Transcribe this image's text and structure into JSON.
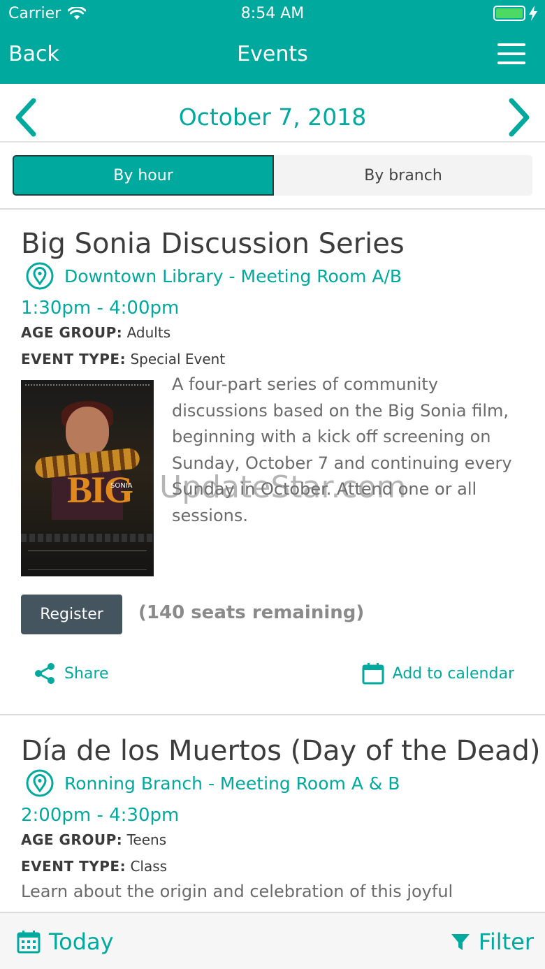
{
  "status_bar": {
    "carrier": "Carrier",
    "time": "8:54 AM"
  },
  "nav": {
    "back_label": "Back",
    "title": "Events"
  },
  "date_nav": {
    "date": "October 7, 2018"
  },
  "view_toggle": {
    "by_hour": "By hour",
    "by_branch": "By branch",
    "selected": "By hour"
  },
  "events": [
    {
      "title": "Big Sonia Discussion Series",
      "location": "Downtown Library - Meeting Room A/B",
      "time": "1:30pm - 4:00pm",
      "age_group_label": "AGE GROUP:",
      "age_group": "Adults",
      "event_type_label": "EVENT TYPE:",
      "event_type": "Special Event",
      "description": "A four-part series of community discussions based on the Big Sonia film, beginning with a kick off screening on Sunday, October 7 and continuing every Sunday in October. Attend one or all sessions.",
      "poster_text": "BIG",
      "poster_subtext": "SONIA",
      "register_label": "Register",
      "seats": "(140 seats remaining)",
      "share_label": "Share",
      "calendar_label": "Add to calendar"
    },
    {
      "title": "Día de los Muertos (Day of the Dead)",
      "location": "Ronning Branch - Meeting Room A & B",
      "time": "2:00pm - 4:30pm",
      "age_group_label": "AGE GROUP:",
      "age_group": "Teens",
      "event_type_label": "EVENT TYPE:",
      "event_type": "Class",
      "description": "Learn about the origin and celebration of this joyful"
    }
  ],
  "watermark": "UpdateStar.com",
  "bottom_bar": {
    "today_label": "Today",
    "filter_label": "Filter"
  },
  "colors": {
    "accent": "#00a99d",
    "register_button": "#455560",
    "battery": "#4cd964"
  },
  "icons": [
    "wifi-icon",
    "battery-icon",
    "hamburger-menu-icon",
    "chevron-left-icon",
    "chevron-right-icon",
    "location-pin-icon",
    "share-icon",
    "calendar-icon",
    "filter-icon"
  ]
}
